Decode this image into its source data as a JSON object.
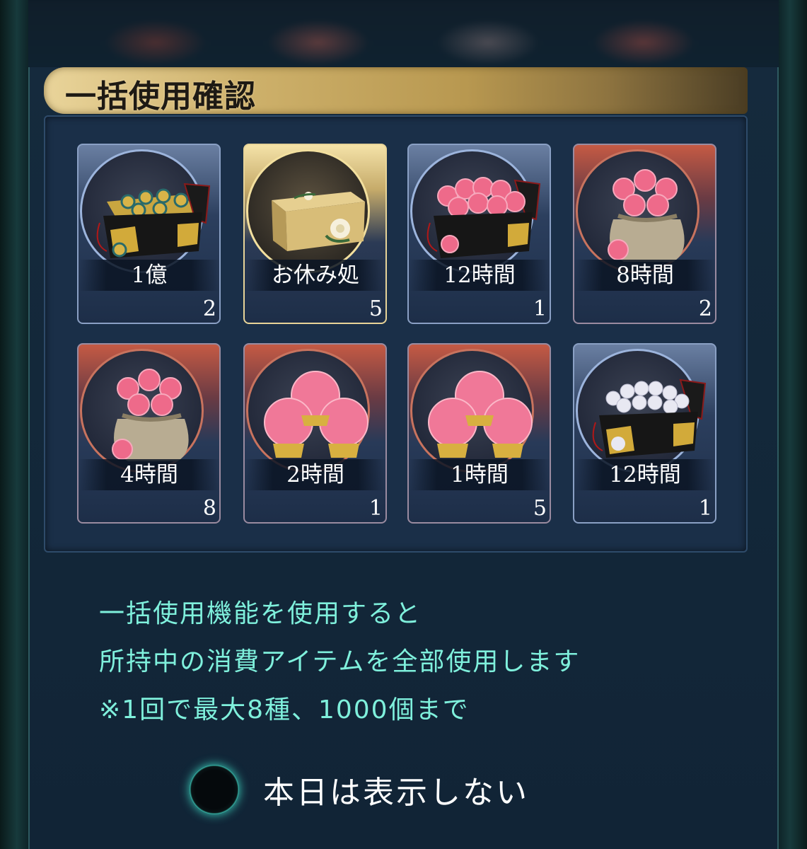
{
  "dialog": {
    "title": "一括使用確認"
  },
  "items": [
    {
      "label": "1億",
      "count": "2",
      "frame": "blue",
      "icon": "coin-chest-icon"
    },
    {
      "label": "お休み処",
      "count": "5",
      "frame": "gold",
      "icon": "golden-box-icon"
    },
    {
      "label": "12時間",
      "count": "1",
      "frame": "blue",
      "icon": "peach-chest-icon"
    },
    {
      "label": "8時間",
      "count": "2",
      "frame": "red",
      "icon": "peach-bag-icon"
    },
    {
      "label": "4時間",
      "count": "8",
      "frame": "red",
      "icon": "peach-bag-icon"
    },
    {
      "label": "2時間",
      "count": "1",
      "frame": "red",
      "icon": "peach-orbs-icon"
    },
    {
      "label": "1時間",
      "count": "5",
      "frame": "red",
      "icon": "peach-orbs-icon"
    },
    {
      "label": "12時間",
      "count": "1",
      "frame": "blue",
      "icon": "pearl-chest-icon"
    }
  ],
  "info": {
    "line1": "一括使用機能を使用すると",
    "line2": "所持中の消費アイテムを全部使用します",
    "line3": "※1回で最大8種、1000個まで"
  },
  "option": {
    "label": "本日は表示しない"
  },
  "colors": {
    "info_text": "#7ff0dc",
    "title_gold": "#cdb06a",
    "panel": "#1a2f48"
  }
}
